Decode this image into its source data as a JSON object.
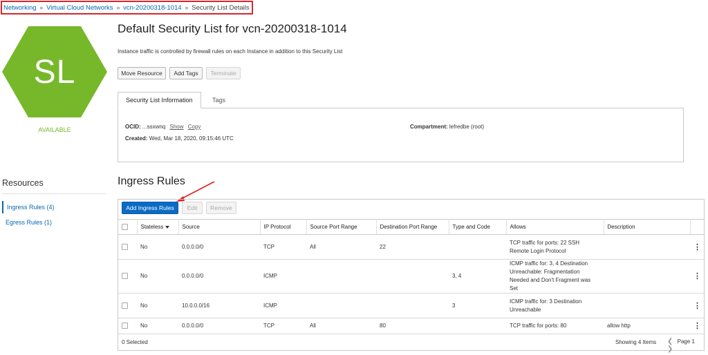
{
  "breadcrumb": {
    "items": [
      "Networking",
      "Virtual Cloud Networks",
      "vcn-20200318-1014"
    ],
    "separator": "»",
    "current": "Security List Details"
  },
  "badge": {
    "initials": "SL",
    "state": "AVAILABLE",
    "color": "#76b82a"
  },
  "header": {
    "title": "Default Security List for vcn-20200318-1014",
    "description": "Instance traffic is controlled by firewall rules on each Instance in addition to this Security List",
    "buttons": {
      "move": "Move Resource",
      "tags": "Add Tags",
      "terminate": "Terminate"
    }
  },
  "tabs": {
    "info": "Security List Information",
    "tags": "Tags"
  },
  "info": {
    "ocid_label": "OCID:",
    "ocid_value": "...ssxwnq",
    "show": "Show",
    "copy": "Copy",
    "created_label": "Created:",
    "created_value": "Wed, Mar 18, 2020, 09:15:46 UTC",
    "compartment_label": "Compartment:",
    "compartment_value": "lefredbe (root)"
  },
  "resources": {
    "title": "Resources",
    "items": [
      "Ingress Rules (4)",
      "Egress Rules (1)"
    ]
  },
  "ingress": {
    "title": "Ingress Rules",
    "buttons": {
      "add": "Add Ingress Rules",
      "edit": "Edit",
      "remove": "Remove"
    },
    "columns": [
      "Stateless",
      "Source",
      "IP Protocol",
      "Source Port Range",
      "Destination Port Range",
      "Type and Code",
      "Allows",
      "Description"
    ],
    "rows": [
      {
        "stateless": "No",
        "source": "0.0.0.0/0",
        "protocol": "TCP",
        "src_port": "All",
        "dst_port": "22",
        "type_code": "",
        "allows": "TCP traffic for ports: 22 SSH Remote Login Protocol",
        "description": ""
      },
      {
        "stateless": "No",
        "source": "0.0.0.0/0",
        "protocol": "ICMP",
        "src_port": "",
        "dst_port": "",
        "type_code": "3, 4",
        "allows": "ICMP traffic for: 3, 4 Destination Unreachable: Fragmentation Needed and Don't Fragment was Set",
        "description": ""
      },
      {
        "stateless": "No",
        "source": "10.0.0.0/16",
        "protocol": "ICMP",
        "src_port": "",
        "dst_port": "",
        "type_code": "3",
        "allows": "ICMP traffic for: 3 Destination Unreachable",
        "description": ""
      },
      {
        "stateless": "No",
        "source": "0.0.0.0/0",
        "protocol": "TCP",
        "src_port": "All",
        "dst_port": "80",
        "type_code": "",
        "allows": "TCP traffic for ports: 80",
        "description": "allow http"
      }
    ],
    "footer": {
      "selected": "0 Selected",
      "showing": "Showing 4 Items",
      "page": "Page 1"
    }
  },
  "colors": {
    "link": "#0b66b2",
    "primary_button": "#0a6bc4",
    "highlight_box": "#d9262b",
    "annotation_arrow": "#e02020"
  }
}
